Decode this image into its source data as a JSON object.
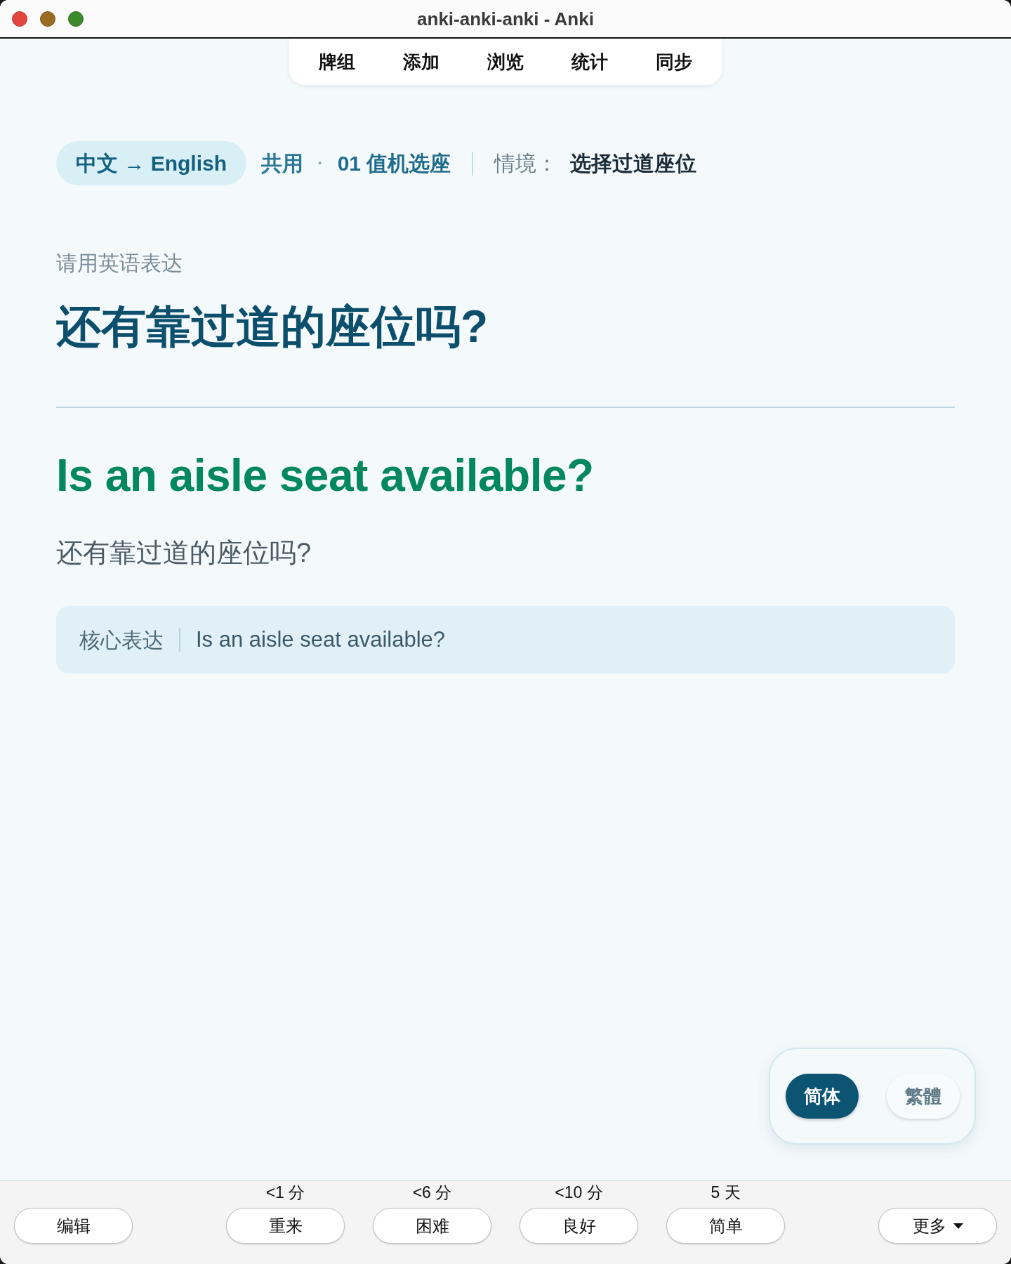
{
  "window": {
    "title": "anki-anki-anki - Anki"
  },
  "top_nav": {
    "items": [
      "牌组",
      "添加",
      "浏览",
      "统计",
      "同步"
    ]
  },
  "breadcrumb": {
    "direction": "中文 → English",
    "deck": "共用",
    "separator": "·",
    "lesson": "01 值机选座",
    "scene_label": "情境：",
    "scene": "选择过道座位"
  },
  "prompt": {
    "instruction": "请用英语表达",
    "question": "还有靠过道的座位吗?"
  },
  "answer": {
    "english": "Is an aisle seat available?",
    "chinese": "还有靠过道的座位吗?"
  },
  "core_expression": {
    "label": "核心表达",
    "text": "Is an aisle seat available?"
  },
  "script_switch": {
    "options": [
      {
        "label": "简体",
        "selected": true
      },
      {
        "label": "繁體",
        "selected": false
      }
    ]
  },
  "answer_bar": {
    "edit_button": "编辑",
    "ease_buttons": [
      {
        "interval": "<1 分",
        "label": "重来"
      },
      {
        "interval": "<6 分",
        "label": "困难"
      },
      {
        "interval": "<10 分",
        "label": "良好"
      },
      {
        "interval": "5 天",
        "label": "简单"
      }
    ],
    "more_button": "更多"
  }
}
